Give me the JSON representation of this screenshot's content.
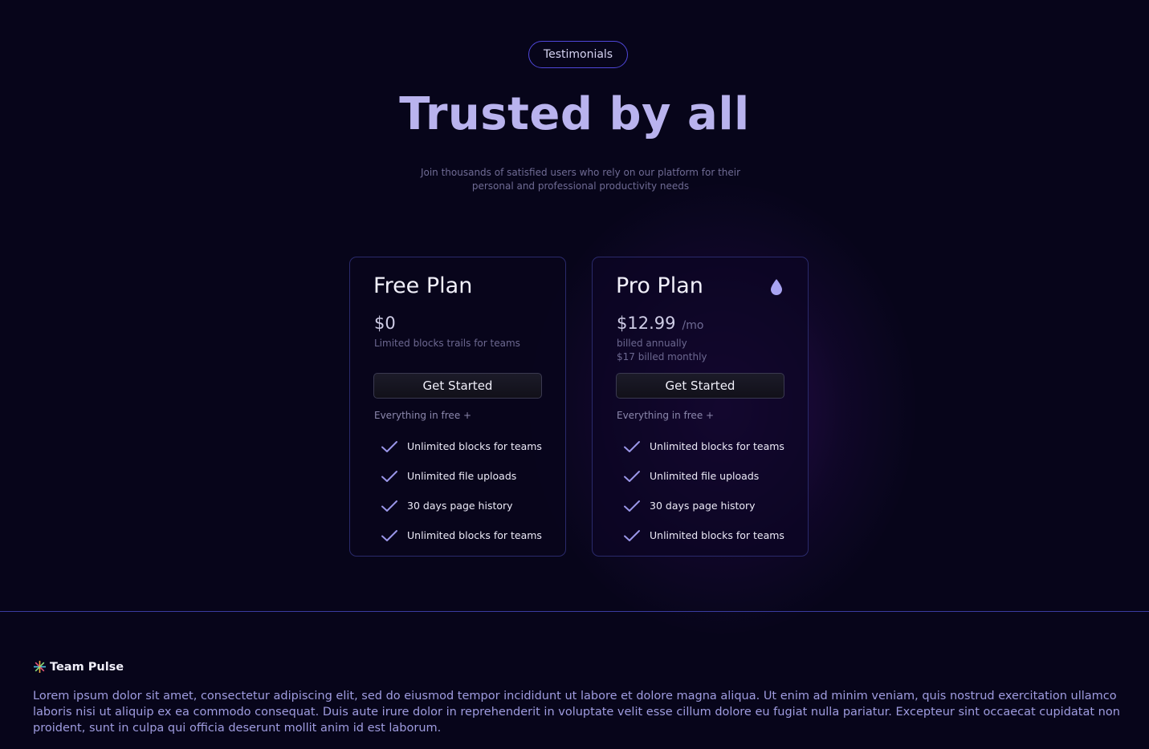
{
  "badge": {
    "label": "Testimonials"
  },
  "hero": {
    "title": "Trusted by all",
    "subtitle": "Join thousands of satisfied users who rely on our platform for their personal and professional productivity needs"
  },
  "plans": [
    {
      "name": "Free Plan",
      "price": "$0",
      "period": "",
      "notes": [
        "Limited blocks trails for teams"
      ],
      "button": "Get Started",
      "includes": "Everything in free +",
      "features": [
        "Unlimited blocks for teams",
        "Unlimited file uploads",
        "30 days page history",
        "Unlimited blocks for teams"
      ]
    },
    {
      "name": "Pro Plan",
      "icon": "drop-icon",
      "price": "$12.99",
      "period": "/mo",
      "notes": [
        "billed annually",
        "$17 billed monthly"
      ],
      "button": "Get Started",
      "includes": "Everything in free +",
      "features": [
        "Unlimited blocks for teams",
        "Unlimited file uploads",
        "30 days page history",
        "Unlimited blocks for teams"
      ]
    }
  ],
  "footer": {
    "brand": "Team Pulse",
    "brand_icon": "sparkle-icon",
    "text": "Lorem ipsum dolor sit amet, consectetur adipiscing elit, sed do eiusmod tempor incididunt ut labore et dolore magna aliqua. Ut enim ad minim veniam, quis nostrud exercitation ullamco laboris nisi ut aliquip ex ea commodo consequat. Duis aute irure dolor in reprehenderit in voluptate velit esse cillum dolore eu fugiat nulla pariatur. Excepteur sint occaecat cupidatat non proident, sunt in culpa qui officia deserunt mollit anim id est laborum."
  },
  "colors": {
    "background": "#07051a",
    "accent": "#4f47d9",
    "title": "#b9b3ee",
    "check": "#9a96e8"
  }
}
